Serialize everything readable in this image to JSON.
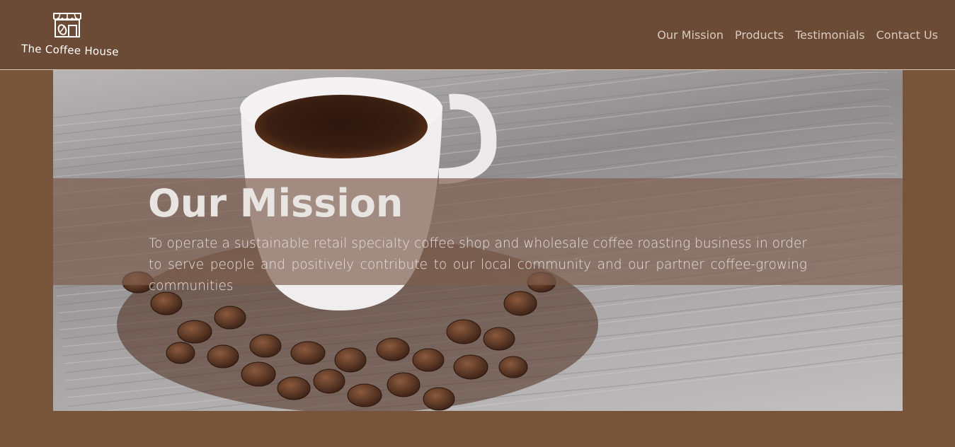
{
  "brand": {
    "name": "The Coffee House",
    "icon": "coffee-shop-icon"
  },
  "nav": {
    "items": [
      {
        "label": "Our Mission"
      },
      {
        "label": "Products"
      },
      {
        "label": "Testimonials"
      },
      {
        "label": "Contact Us"
      }
    ]
  },
  "hero": {
    "image": "coffee-cup-and-beans-photo",
    "title": "Our Mission",
    "text": "To operate a sustainable retail specialty coffee shop and wholesale coffee roasting business in order to serve people and positively contribute to our local community and our partner coffee-growing communities"
  },
  "colors": {
    "header_bg": "#6c4b36",
    "page_bg": "#78543a",
    "band_overlay": "#7d5d4c",
    "nav_text": "#d9cbbe"
  }
}
